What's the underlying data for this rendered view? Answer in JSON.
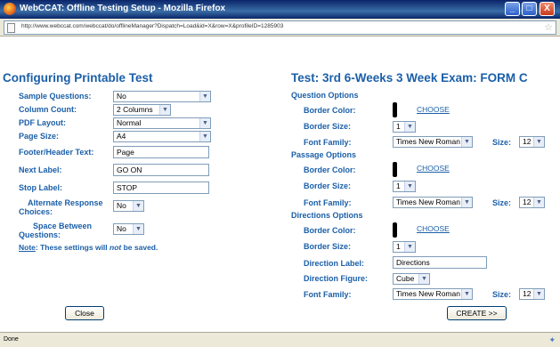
{
  "window": {
    "title": "WebCCAT: Offline Testing Setup - Mozilla Firefox",
    "minimize": "_",
    "maximize": "□",
    "close": "X"
  },
  "url": "http://www.webccat.com/webccat/do/offlineManager?Dispatch=Load&id=X&row=X&profileID=1285903",
  "left": {
    "heading": "Configuring Printable Test",
    "fields": {
      "sample_questions": {
        "label": "Sample Questions:",
        "value": "No"
      },
      "column_count": {
        "label": "Column Count:",
        "value": "2 Columns"
      },
      "pdf_layout": {
        "label": "PDF Layout:",
        "value": "Normal"
      },
      "page_size": {
        "label": "Page Size:",
        "value": "A4"
      },
      "footer_header": {
        "label": "Footer/Header Text:",
        "value": "Page"
      },
      "next_label": {
        "label": "Next Label:",
        "value": "GO ON"
      },
      "stop_label": {
        "label": "Stop Label:",
        "value": "STOP"
      },
      "alt_response": {
        "label_line1": "Alternate Response",
        "label_line2": "Choices:",
        "value": "No"
      },
      "space_between": {
        "label_line1": "Space Between",
        "label_line2": "Questions:",
        "value": "No"
      }
    },
    "note": {
      "prefix": "Note",
      "part1": ": These settings will ",
      "em": "not",
      "part2": " be saved."
    },
    "close_button": "Close"
  },
  "right": {
    "heading": "Test:   3rd 6-Weeks 3 Week Exam: FORM C",
    "question_options": {
      "title": "Question Options",
      "border_color_label": "Border Color:",
      "choose": "CHOOSE",
      "border_size_label": "Border Size:",
      "border_size": "1",
      "font_family_label": "Font Family:",
      "font_family": "Times New Roman",
      "size_label": "Size:",
      "size": "12"
    },
    "passage_options": {
      "title": "Passage Options",
      "border_color_label": "Border Color:",
      "choose": "CHOOSE",
      "border_size_label": "Border Size:",
      "border_size": "1",
      "font_family_label": "Font Family:",
      "font_family": "Times New Roman",
      "size_label": "Size:",
      "size": "12"
    },
    "directions_options": {
      "title": "Directions Options",
      "border_color_label": "Border Color:",
      "choose": "CHOOSE",
      "border_size_label": "Border Size:",
      "border_size": "1",
      "direction_label_label": "Direction Label:",
      "direction_label": "Directions",
      "direction_figure_label": "Direction Figure:",
      "direction_figure": "Cube",
      "font_family_label": "Font Family:",
      "font_family": "Times New Roman",
      "size_label": "Size:",
      "size": "12"
    },
    "create_button": "CREATE >>"
  },
  "status": {
    "text": "Done"
  },
  "colors": {
    "label": "#1b5fa8",
    "titlebar": "#0a246a",
    "swatch": "#000000"
  }
}
